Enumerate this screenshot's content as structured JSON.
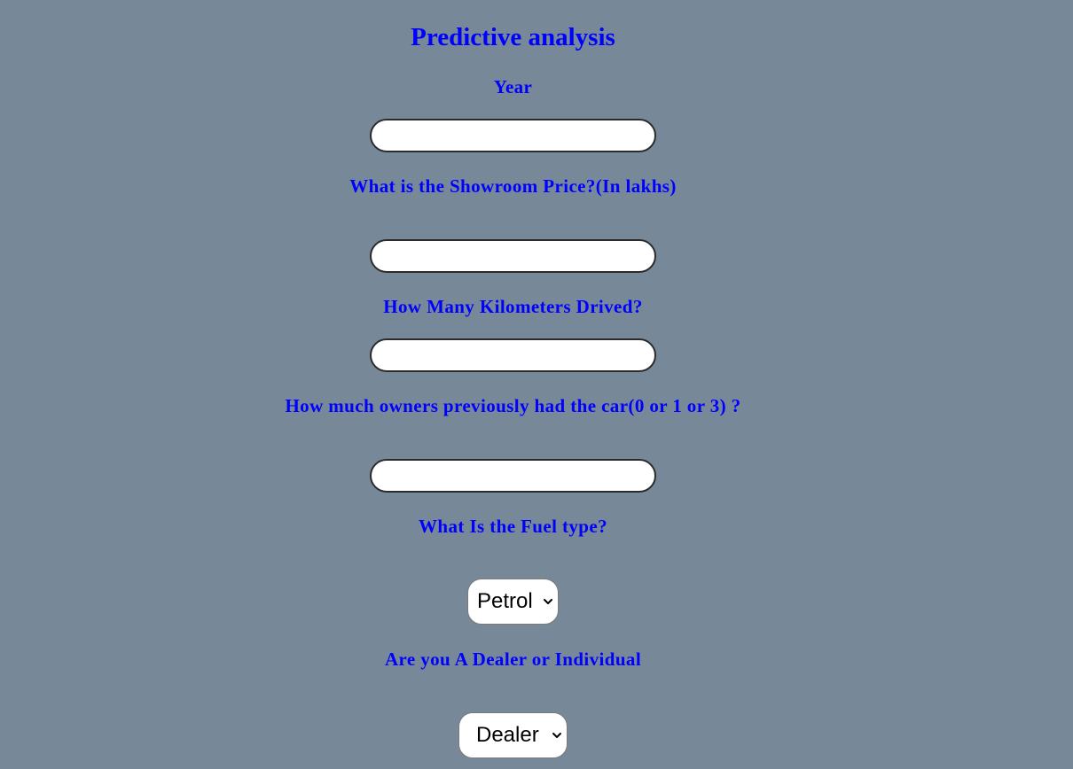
{
  "page": {
    "title": "Predictive analysis",
    "background": "#778899",
    "accent": "#0000ff"
  },
  "form": {
    "year": {
      "label": "Year",
      "value": "",
      "placeholder": ""
    },
    "showroom_price": {
      "label": "What is the Showroom Price?(In lakhs)",
      "value": "",
      "placeholder": ""
    },
    "kms_driven": {
      "label": "How Many Kilometers Drived?",
      "value": "",
      "placeholder": ""
    },
    "owners": {
      "label": "How much owners previously had the car(0 or 1 or 3) ?",
      "value": "",
      "placeholder": ""
    },
    "fuel_type": {
      "label": "What Is the Fuel type?",
      "selected": "Petrol",
      "icon": "chevron-down-icon"
    },
    "seller_type": {
      "label": "Are you A Dealer or Individual",
      "selected": "Dealer",
      "icon": "chevron-down-icon"
    }
  }
}
